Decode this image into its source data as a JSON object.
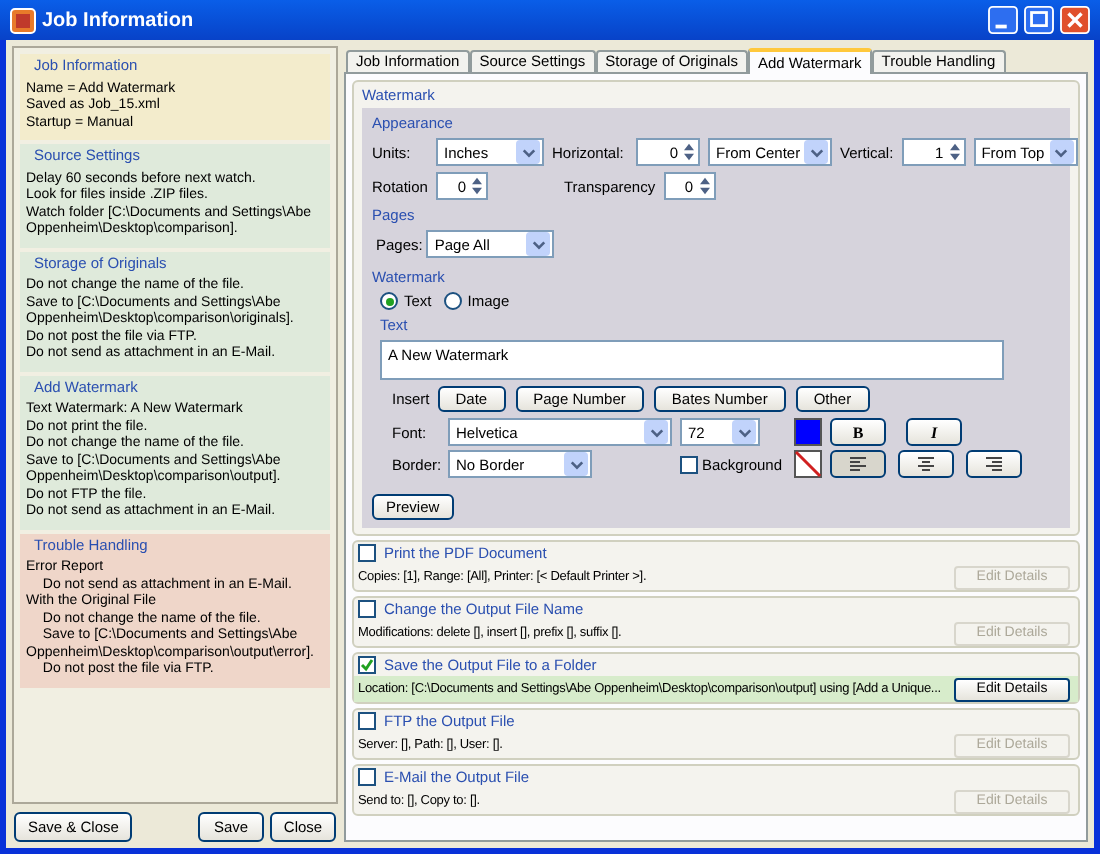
{
  "window": {
    "title": "Job Information"
  },
  "summary": [
    {
      "title": "Job Information",
      "color": "#f3eccc",
      "lines": [
        {
          "text": "Name = Add Watermark"
        },
        {
          "text": "Saved as Job_15.xml"
        },
        {
          "text": "Startup = Manual"
        }
      ]
    },
    {
      "title": "Source Settings",
      "color": "#dfeadb",
      "lines": [
        {
          "text": "Delay 60 seconds before next watch."
        },
        {
          "text": "Look for files inside .ZIP files."
        },
        {
          "text": "Watch folder [C:\\Documents and Settings\\Abe Oppenheim\\Desktop\\comparison]."
        }
      ]
    },
    {
      "title": "Storage of Originals",
      "color": "#dfeadb",
      "lines": [
        {
          "text": "Do not change the name of the file."
        },
        {
          "text": "Save to [C:\\Documents and Settings\\Abe Oppenheim\\Desktop\\comparison\\originals]."
        },
        {
          "text": "Do not post the file via FTP."
        },
        {
          "text": "Do not send as attachment in an E-Mail."
        }
      ]
    },
    {
      "title": "Add Watermark",
      "color": "#dfeadb",
      "lines": [
        {
          "text": "Text Watermark: A New Watermark"
        },
        {
          "text": "Do not print the file."
        },
        {
          "text": "Do not change the name of the file."
        },
        {
          "text": "Save to [C:\\Documents and Settings\\Abe Oppenheim\\Desktop\\comparison\\output]."
        },
        {
          "text": "Do not FTP the file."
        },
        {
          "text": "Do not send as attachment in an E-Mail."
        }
      ]
    },
    {
      "title": "Trouble Handling",
      "color": "#efd6c9",
      "lines": [
        {
          "text": "Error Report",
          "children": [
            {
              "text": "Do not send as attachment in an E-Mail."
            }
          ]
        },
        {
          "text": "With the Original File",
          "children": [
            {
              "text": "Do not change the name of the file."
            },
            {
              "text": "Save to [C:\\Documents and Settings\\Abe Oppenheim\\Desktop\\comparison\\output\\error]."
            },
            {
              "text": "Do not post the file via FTP."
            }
          ]
        }
      ]
    }
  ],
  "left_buttons": [
    "Save & Close"
  ],
  "right_buttons": [
    "Save",
    "Close"
  ],
  "tabs": [
    {
      "label": "Job Information",
      "selected": false
    },
    {
      "label": "Source Settings",
      "selected": false
    },
    {
      "label": "Storage of Originals",
      "selected": false
    },
    {
      "label": "Add Watermark",
      "selected": true
    },
    {
      "label": "Trouble Handling",
      "selected": false
    }
  ],
  "watermark": {
    "title": "Watermark",
    "appearance": {
      "title": "Appearance",
      "units": {
        "label": "Units:",
        "value": "Inches"
      },
      "horizontal": {
        "label": "Horizontal:",
        "value": "0",
        "anchor": "From Center"
      },
      "vertical": {
        "label": "Vertical:",
        "value": "1",
        "anchor": "From Top"
      },
      "rotation": {
        "label": "Rotation",
        "value": "0"
      },
      "transparency": {
        "label": "Transparency",
        "value": "0"
      }
    },
    "pages": {
      "title": "Pages",
      "label": "Pages:",
      "value": "Page All"
    },
    "type": {
      "title": "Watermark",
      "options": [
        {
          "label": "Text",
          "selected": true
        },
        {
          "label": "Image",
          "selected": false
        }
      ]
    },
    "text": {
      "title": "Text",
      "value": "A New Watermark"
    },
    "insert": {
      "label": "Insert",
      "buttons": [
        "Date",
        "Page Number",
        "Bates Number",
        "Other"
      ]
    },
    "font": {
      "label": "Font:",
      "value": "Helvetica",
      "size": "72",
      "color": "#0000ff",
      "bold_label": "B",
      "italic_label": "I"
    },
    "border": {
      "label": "Border:",
      "value": "No Border",
      "background": {
        "label": "Background",
        "checked": false
      },
      "alignments": [
        {
          "kind": "left",
          "selected": true
        },
        {
          "kind": "center",
          "selected": false
        },
        {
          "kind": "right",
          "selected": false
        }
      ]
    },
    "preview": "Preview"
  },
  "actions": [
    {
      "title": "Print the PDF Document",
      "checked": false,
      "description": "Copies: [1], Range: [All], Printer: [< Default Printer >].",
      "button": "Edit Details"
    },
    {
      "title": "Change the Output File Name",
      "checked": false,
      "description": "Modifications: delete [], insert [], prefix [], suffix [].",
      "button": "Edit Details"
    },
    {
      "title": "Save the Output File to a Folder",
      "checked": true,
      "description": "Location: [C:\\Documents and Settings\\Abe Oppenheim\\Desktop\\comparison\\output] using [Add a Unique...",
      "button": "Edit Details"
    },
    {
      "title": "FTP the Output File",
      "checked": false,
      "description": "Server: [], Path: [], User: [].",
      "button": "Edit Details"
    },
    {
      "title": "E-Mail the Output File",
      "checked": false,
      "description": "Send to: [], Copy to: [].",
      "button": "Edit Details"
    }
  ]
}
